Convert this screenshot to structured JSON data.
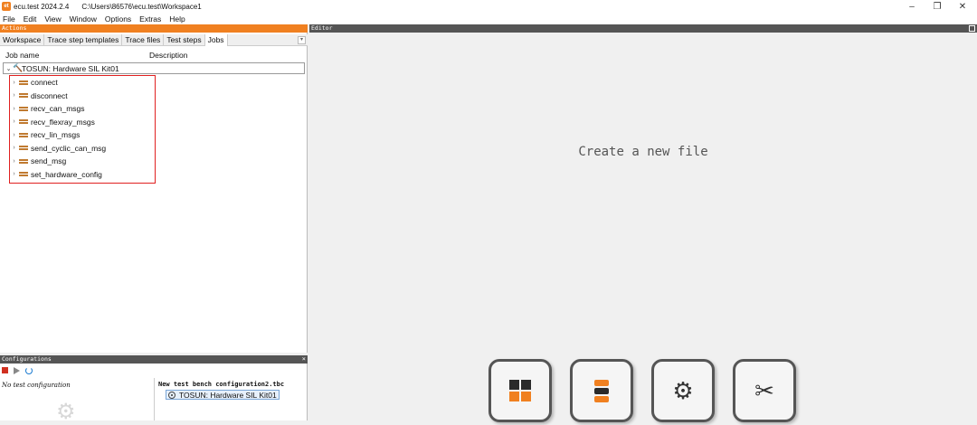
{
  "window": {
    "app_icon": "et",
    "title": "ecu.test 2024.2.4",
    "path": "C:\\Users\\86576\\ecu.test\\Workspace1"
  },
  "menu": [
    "File",
    "Edit",
    "View",
    "Window",
    "Options",
    "Extras",
    "Help"
  ],
  "actions_panel": {
    "header": "Actions",
    "tabs": [
      "Workspace",
      "Trace step templates",
      "Trace files",
      "Test steps",
      "Jobs"
    ],
    "active_tab": "Jobs",
    "columns": [
      "Job name",
      "Description"
    ],
    "root": "TOSUN: Hardware SIL Kit01",
    "jobs": [
      "connect",
      "disconnect",
      "recv_can_msgs",
      "recv_flexray_msgs",
      "recv_lin_msgs",
      "send_cyclic_can_msg",
      "send_msg",
      "set_hardware_config"
    ]
  },
  "configurations_panel": {
    "header": "Configurations",
    "close": "×",
    "left_text": "No test configuration",
    "bench_title": "New test bench configuration2.tbc",
    "bench_item": "TOSUN: Hardware SIL Kit01"
  },
  "editor": {
    "header": "Editor",
    "placeholder": "Create a new file",
    "buttons": [
      {
        "icon": "package-icon",
        "glyph": ""
      },
      {
        "icon": "stack-icon",
        "glyph": ""
      },
      {
        "icon": "gears-icon",
        "glyph": "⚙"
      },
      {
        "icon": "tools-icon",
        "glyph": "✂"
      }
    ]
  },
  "colors": {
    "accent": "#f08020",
    "pane_header": "#555555",
    "highlight_border": "#e02020"
  }
}
